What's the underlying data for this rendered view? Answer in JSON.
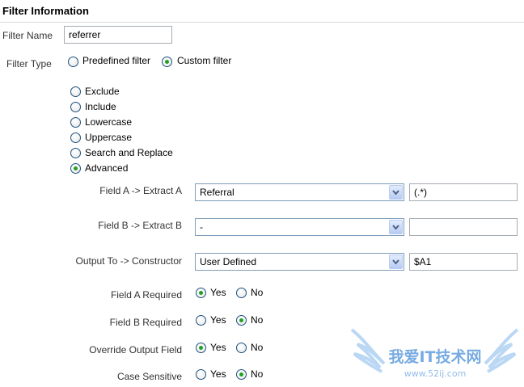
{
  "section": {
    "title": "Filter Information"
  },
  "filter_name": {
    "label": "Filter Name",
    "value": "referrer"
  },
  "filter_type": {
    "label": "Filter Type",
    "predefined_label": "Predefined filter",
    "custom_label": "Custom filter",
    "selected": "custom"
  },
  "custom_options": [
    {
      "label": "Exclude",
      "checked": false
    },
    {
      "label": "Include",
      "checked": false
    },
    {
      "label": "Lowercase",
      "checked": false
    },
    {
      "label": "Uppercase",
      "checked": false
    },
    {
      "label": "Search and Replace",
      "checked": false
    },
    {
      "label": "Advanced",
      "checked": true
    }
  ],
  "advanced": {
    "field_a": {
      "label": "Field A -> Extract A",
      "select": "Referral",
      "value": "(.*)"
    },
    "field_b": {
      "label": "Field B -> Extract B",
      "select": "-",
      "value": ""
    },
    "output": {
      "label": "Output To -> Constructor",
      "select": "User Defined",
      "value": "$A1"
    }
  },
  "yes_label": "Yes",
  "no_label": "No",
  "toggles": {
    "field_a_required": {
      "label": "Field A Required",
      "value": "Yes"
    },
    "field_b_required": {
      "label": "Field B Required",
      "value": "No"
    },
    "override_output": {
      "label": "Override Output Field",
      "value": "Yes"
    },
    "case_sensitive": {
      "label": "Case Sensitive",
      "value": "No"
    }
  },
  "watermark": {
    "text": "我爱IT技术网",
    "url": "www.52ij.com"
  },
  "colors": {
    "radio_dot": "#21a121",
    "radio_border": "#1c5180",
    "select_btn": "#b6cbf3",
    "watermark": "#4a90d9"
  }
}
